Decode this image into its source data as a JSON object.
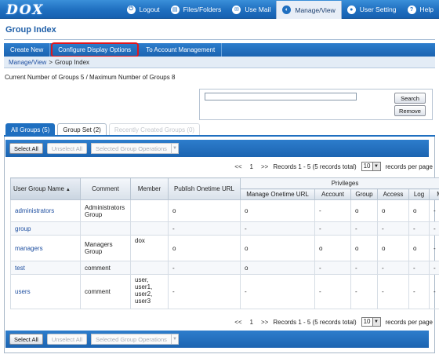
{
  "app": {
    "logo": "DOX"
  },
  "topnav": [
    {
      "label": "Logout",
      "icon": "logout-icon",
      "glyph": "⏻"
    },
    {
      "label": "Files/Folders",
      "icon": "folder-icon",
      "glyph": "▤"
    },
    {
      "label": "Use Mail",
      "icon": "mail-icon",
      "glyph": "✉"
    },
    {
      "label": "Manage/View",
      "icon": "manage-icon",
      "glyph": "◐",
      "active": true
    },
    {
      "label": "User Setting",
      "icon": "user-icon",
      "glyph": "●"
    },
    {
      "label": "Help",
      "icon": "help-icon",
      "glyph": "?"
    }
  ],
  "page": {
    "title": "Group Index"
  },
  "subnav": [
    {
      "label": "Create New"
    },
    {
      "label": "Configure Display Options",
      "highlighted": true
    },
    {
      "label": "To Account Management"
    }
  ],
  "breadcrumb": {
    "parent": "Manage/View",
    "separator": ">",
    "current": "Group Index"
  },
  "group_count": "Current Number of Groups 5 / Maximum Number of Groups 8",
  "search": {
    "value": "",
    "search_label": "Search",
    "remove_label": "Remove"
  },
  "tabs": [
    {
      "label": "All Groups (5)",
      "state": "active"
    },
    {
      "label": "Group Set (2)",
      "state": "normal"
    },
    {
      "label": "Recently Created Groups (0)",
      "state": "disabled"
    }
  ],
  "actions": {
    "select_all": "Select All",
    "unselect_all": "Unselect All",
    "group_ops": "Selected Group Operations"
  },
  "paging": {
    "prev": "<<",
    "page": "1",
    "next": ">>",
    "records": "Records 1 - 5 (5 records total)",
    "per_page": "10",
    "per_page_label": "records per page"
  },
  "table": {
    "privileges_header": "Privileges",
    "columns": [
      "User Group Name",
      "Comment",
      "Member",
      "Publish Onetime URL",
      "Manage Onetime URL",
      "Account",
      "Group",
      "Access",
      "Log",
      "M"
    ],
    "rows": [
      {
        "name": "administrators",
        "comment": "Administrators Group",
        "member": "",
        "cells": [
          "o",
          "o",
          "-",
          "o",
          "o",
          "o",
          "-"
        ]
      },
      {
        "name": "group",
        "comment": "",
        "member": "",
        "cells": [
          "-",
          "-",
          "-",
          "-",
          "-",
          "-",
          "-"
        ]
      },
      {
        "name": "managers",
        "comment": "Managers Group",
        "member": "dox",
        "cells": [
          "o",
          "o",
          "o",
          "o",
          "o",
          "o",
          "-"
        ]
      },
      {
        "name": "test",
        "comment": "comment",
        "member": "",
        "cells": [
          "-",
          "o",
          "-",
          "-",
          "-",
          "-",
          "-"
        ]
      },
      {
        "name": "users",
        "comment": "comment",
        "member": "user, user1, user2, user3",
        "cells": [
          "-",
          "-",
          "-",
          "-",
          "-",
          "-",
          "-"
        ]
      }
    ]
  }
}
